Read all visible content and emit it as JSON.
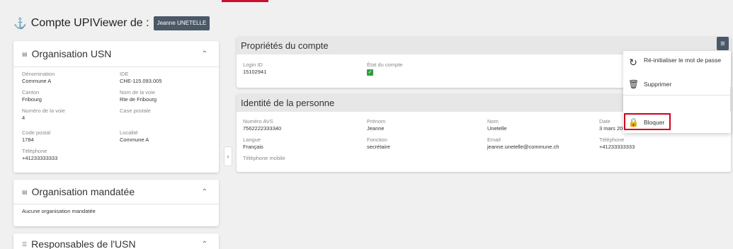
{
  "header": {
    "title": "Compte UPIViewer de :",
    "user": "Jeanne UNETELLE"
  },
  "org_usn": {
    "title": "Organisation USN",
    "fields": [
      {
        "label": "Dénomination",
        "value": "Commune A"
      },
      {
        "label": "IDE",
        "value": "CHE-115.093.005"
      },
      {
        "label": "Canton",
        "value": "Fribourg"
      },
      {
        "label": "Nom de la voie",
        "value": "Rte de Fribourg"
      },
      {
        "label": "Numéro de la voie",
        "value": "4"
      },
      {
        "label": "Case postale",
        "value": ""
      },
      {
        "label": "Code postal",
        "value": "1784"
      },
      {
        "label": "Localité",
        "value": "Commune A"
      },
      {
        "label": "Téléphone",
        "value": "+41233333333"
      }
    ]
  },
  "org_mandatee": {
    "title": "Organisation mandatée",
    "empty_text": "Aucune organisation mandatée"
  },
  "responsables": {
    "title": "Responsables de l'USN"
  },
  "account_props": {
    "title": "Propriétés du compte",
    "login_label": "Login ID",
    "login_value": "15102941",
    "state_label": "État du compte"
  },
  "identity": {
    "title": "Identité de la personne",
    "fields": [
      {
        "label": "Numéro AVS",
        "value": "7562222333340"
      },
      {
        "label": "Prénom",
        "value": "Jeanne"
      },
      {
        "label": "Nom",
        "value": "Unetelle"
      },
      {
        "label": "Date",
        "value": "3 mars 2003"
      },
      {
        "label": "Langue",
        "value": "Français"
      },
      {
        "label": "Fonction",
        "value": "secrétaire"
      },
      {
        "label": "Email",
        "value": "jeanne.unetelle@commune.ch"
      },
      {
        "label": "Téléphone",
        "value": "+41233333333"
      },
      {
        "label": "Téléphone mobile",
        "value": ""
      }
    ]
  },
  "menu": {
    "items": [
      {
        "label": "Ré-initialiser le mot de passe",
        "icon": "refresh-icon"
      },
      {
        "label": "Supprimer",
        "icon": "trash-icon"
      },
      {
        "label": "Bloquer",
        "icon": "lock-icon"
      }
    ]
  },
  "colors": {
    "badge": "#4a5868",
    "highlight": "#d0021b",
    "accent_red": "#c8102e",
    "status_green": "#2e9e3e"
  }
}
